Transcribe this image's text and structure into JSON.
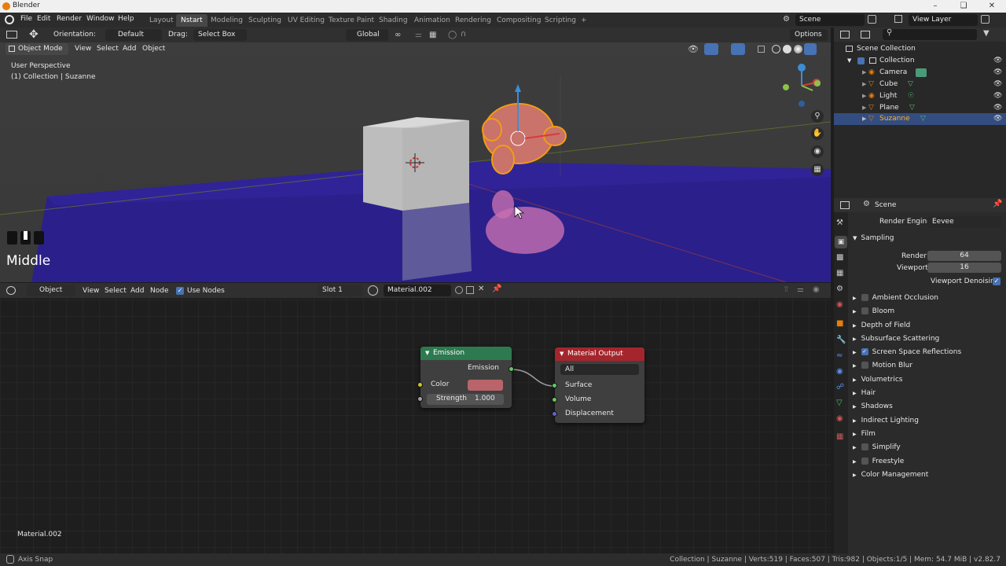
{
  "window": {
    "title": "Blender"
  },
  "menu": [
    "File",
    "Edit",
    "Render",
    "Window",
    "Help"
  ],
  "workspaces": [
    "Layout",
    "Nstart",
    "Modeling",
    "Sculpting",
    "UV Editing",
    "Texture Paint",
    "Shading",
    "Animation",
    "Rendering",
    "Compositing",
    "Scripting",
    "+"
  ],
  "active_workspace": "Nstart",
  "scene_name": "Scene",
  "view_layer": "View Layer",
  "tool_header": {
    "orientation_label": "Orientation:",
    "orientation_value": "Default",
    "drag_label": "Drag:",
    "drag_value": "Select Box",
    "transform_orientation": "Global",
    "options": "Options"
  },
  "viewport": {
    "mode": "Object Mode",
    "menus": [
      "View",
      "Select",
      "Add",
      "Object"
    ],
    "view_name": "User Perspective",
    "collection_info": "(1) Collection | Suzanne",
    "key_overlay": "Middle"
  },
  "node_editor": {
    "object_type": "Object",
    "menus": [
      "View",
      "Select",
      "Add",
      "Node"
    ],
    "use_nodes": "Use Nodes",
    "slot": "Slot 1",
    "material": "Material.002",
    "footer_material": "Material.002",
    "emission_node": {
      "title": "Emission",
      "output": "Emission",
      "color_label": "Color",
      "color": "#b9646b",
      "strength_label": "Strength",
      "strength_value": "1.000"
    },
    "output_node": {
      "title": "Material Output",
      "target": "All",
      "surface": "Surface",
      "volume": "Volume",
      "displacement": "Displacement"
    }
  },
  "outliner": {
    "root": "Scene Collection",
    "collection": "Collection",
    "items": [
      "Camera",
      "Cube",
      "Light",
      "Plane",
      "Suzanne"
    ],
    "selected": "Suzanne"
  },
  "properties": {
    "context": "Scene",
    "render_engine_label": "Render Engine",
    "render_engine": "Eevee",
    "sampling": "Sampling",
    "render_label": "Render",
    "render_samples": "64",
    "viewport_label": "Viewport",
    "viewport_samples": "16",
    "viewport_denoising": "Viewport Denoising",
    "panels": [
      {
        "label": "Ambient Occlusion",
        "checkbox": true,
        "checked": false
      },
      {
        "label": "Bloom",
        "checkbox": true,
        "checked": false
      },
      {
        "label": "Depth of Field",
        "checkbox": false
      },
      {
        "label": "Subsurface Scattering",
        "checkbox": false
      },
      {
        "label": "Screen Space Reflections",
        "checkbox": true,
        "checked": true
      },
      {
        "label": "Motion Blur",
        "checkbox": true,
        "checked": false
      },
      {
        "label": "Volumetrics",
        "checkbox": false
      },
      {
        "label": "Hair",
        "checkbox": false
      },
      {
        "label": "Shadows",
        "checkbox": false
      },
      {
        "label": "Indirect Lighting",
        "checkbox": false
      },
      {
        "label": "Film",
        "checkbox": false
      },
      {
        "label": "Simplify",
        "checkbox": true,
        "checked": false
      },
      {
        "label": "Freestyle",
        "checkbox": true,
        "checked": false
      },
      {
        "label": "Color Management",
        "checkbox": false
      }
    ]
  },
  "statusbar": {
    "left": "Axis Snap",
    "right": "Collection | Suzanne | Verts:519 | Faces:507 | Tris:982 | Objects:1/5 | Mem: 54.7 MiB | v2.82.7"
  },
  "colors": {
    "accent": "#4772b3",
    "emission_header": "#2d7a4f",
    "output_header": "#a4262c",
    "selection": "#e87d0d"
  }
}
